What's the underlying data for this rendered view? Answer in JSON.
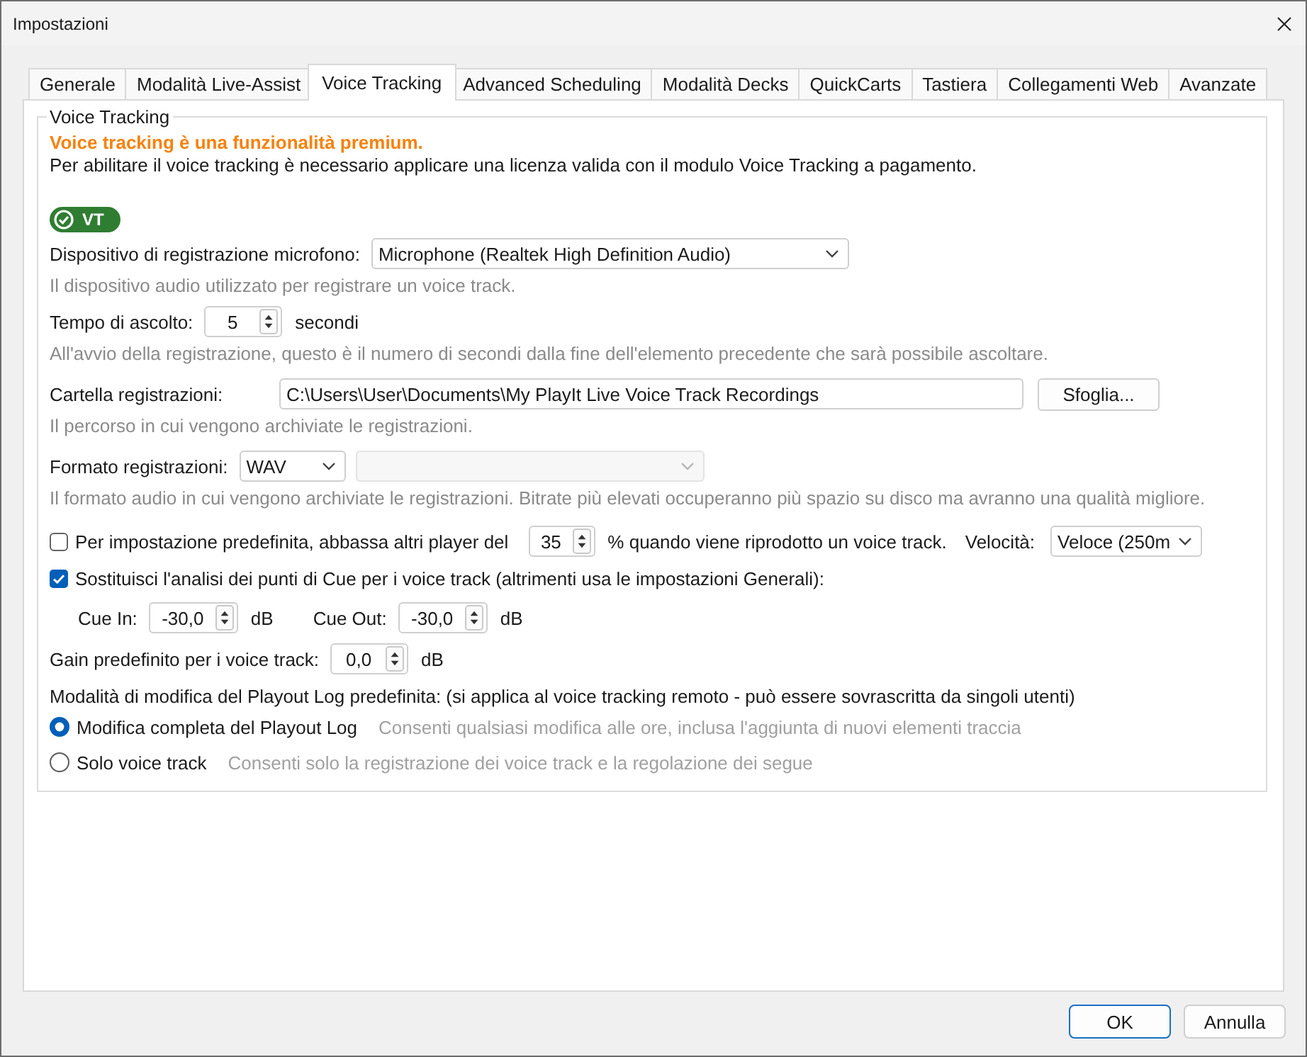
{
  "window": {
    "title": "Impostazioni"
  },
  "tabs": [
    {
      "label": "Generale",
      "selected": false
    },
    {
      "label": "Modalità Live-Assist",
      "selected": false
    },
    {
      "label": "Voice Tracking",
      "selected": true
    },
    {
      "label": "Advanced Scheduling",
      "selected": false
    },
    {
      "label": "Modalità Decks",
      "selected": false
    },
    {
      "label": "QuickCarts",
      "selected": false
    },
    {
      "label": "Tastiera",
      "selected": false
    },
    {
      "label": "Collegamenti Web",
      "selected": false
    },
    {
      "label": "Avanzate",
      "selected": false
    }
  ],
  "group": {
    "title": "Voice Tracking"
  },
  "notice": {
    "heading": "Voice tracking è una funzionalità premium.",
    "text": "Per abilitare il voice tracking è necessario applicare una licenza valida con il modulo Voice Tracking a pagamento."
  },
  "license_badge": {
    "label": "VT"
  },
  "settings": [
    {
      "kind": "dropdown",
      "label": "Dispositivo di registrazione microfono:",
      "value": "Microphone (Realtek High Definition Audio)",
      "hint": "Il dispositivo audio utilizzato per registrare un voice track."
    },
    {
      "kind": "spinner",
      "label": "Tempo di ascolto:",
      "value": "5",
      "unit": "secondi",
      "hint": "All'avvio della registrazione, questo è il numero di secondi dalla fine dell'elemento precedente che sarà possibile ascoltare."
    },
    {
      "kind": "folder",
      "label": "Cartella registrazioni:",
      "value": "C:\\Users\\User\\Documents\\My PlayIt Live Voice Track Recordings",
      "button": "Sfoglia...",
      "hint": "Il percorso in cui vengono archiviate le registrazioni."
    },
    {
      "kind": "format",
      "label": "Formato registrazioni:",
      "value": "WAV",
      "bitrate": {
        "disabled": true
      },
      "hint": "Il formato audio in cui vengono archiviate le registrazioni. Bitrate più elevati occuperanno più spazio su disco ma avranno una qualità migliore."
    },
    {
      "kind": "duck",
      "checked": false,
      "label": "Per impostazione predefinita, abbassa altri player del",
      "value": "35",
      "unit": "% quando viene riprodotto un voice track.",
      "speed_label": "Velocità:",
      "speed": "Veloce (250m"
    },
    {
      "kind": "checkbox",
      "checked": true,
      "label": "Sostituisci l'analisi dei punti di Cue per i voice track (altrimenti usa le impostazioni Generali):",
      "fields": [
        {
          "label": "Cue In:",
          "value": "-30,0",
          "unit": "dB"
        },
        {
          "label": "Cue Out:",
          "value": "-30,0",
          "unit": "dB"
        }
      ]
    },
    {
      "kind": "spinner",
      "label": "Gain predefinito per i voice track:",
      "value": "0,0",
      "unit": "dB"
    }
  ],
  "edit_mode": {
    "label": "Modalità di modifica del Playout Log predefinita: (si applica al voice tracking remoto - può essere sovrascritta da singoli utenti)",
    "options": [
      {
        "label": "Modifica completa del Playout Log",
        "description": "Consenti qualsiasi modifica alle ore, inclusa l'aggiunta di nuovi elementi traccia",
        "selected": true
      },
      {
        "label": "Solo voice track",
        "description": "Consenti solo la registrazione dei voice track e la regolazione dei segue",
        "selected": false
      }
    ]
  },
  "buttons": [
    {
      "label": "OK",
      "default": true
    },
    {
      "label": "Annulla",
      "default": false
    }
  ]
}
